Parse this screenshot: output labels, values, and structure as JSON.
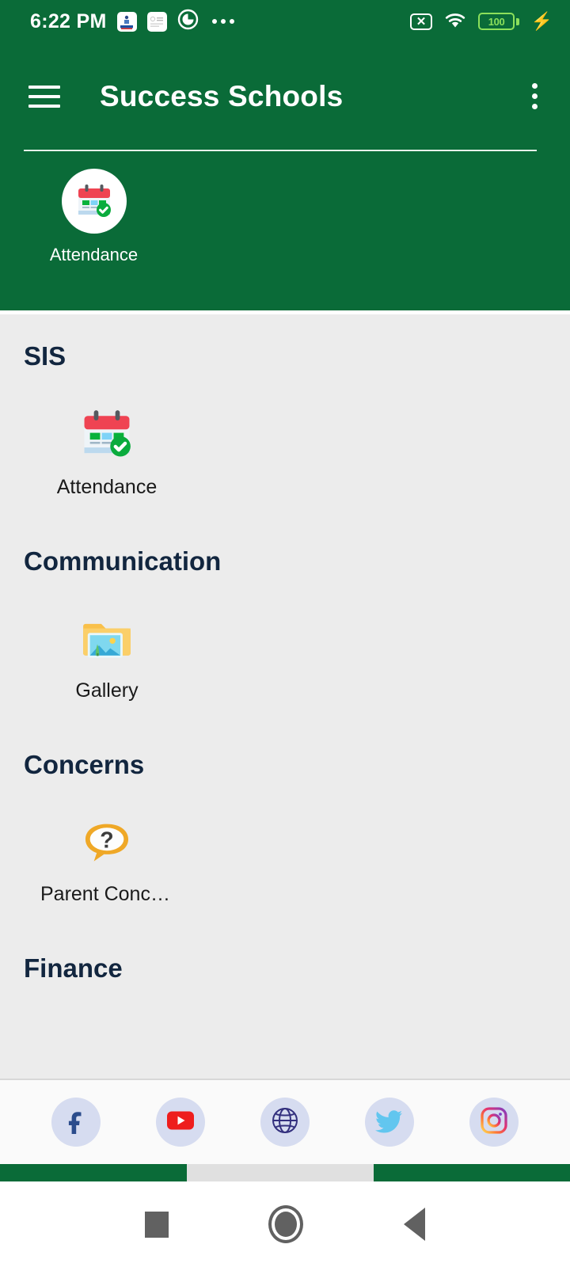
{
  "status_bar": {
    "time": "6:22 PM",
    "notification_icons": [
      "app-badge-icon",
      "document-icon",
      "quicksupport-icon",
      "more-notifications-icon"
    ],
    "sim_icon": "no-sim-icon",
    "sim_glyph": "✕",
    "wifi_icon": "wifi-icon",
    "battery_level": "100",
    "battery_icon": "battery-icon",
    "charging_icon": "charging-bolt-icon",
    "charging_glyph": "⚡"
  },
  "app_bar": {
    "menu_icon": "hamburger-menu-icon",
    "title": "Success Schools",
    "overflow_icon": "overflow-menu-icon"
  },
  "favorites": {
    "items": [
      {
        "label": "Attendance",
        "icon": "calendar-check-icon"
      }
    ]
  },
  "sections": [
    {
      "title": "SIS",
      "items": [
        {
          "label": "Attendance",
          "icon": "calendar-check-icon"
        }
      ]
    },
    {
      "title": "Communication",
      "items": [
        {
          "label": "Gallery",
          "icon": "photo-folder-icon"
        }
      ]
    },
    {
      "title": "Concerns",
      "items": [
        {
          "label": "Parent Conce…",
          "icon": "question-bubble-icon"
        }
      ]
    },
    {
      "title": "Finance",
      "items": []
    }
  ],
  "social_bar": {
    "items": [
      {
        "name": "facebook",
        "icon": "facebook-icon"
      },
      {
        "name": "youtube",
        "icon": "youtube-icon"
      },
      {
        "name": "website",
        "icon": "globe-icon"
      },
      {
        "name": "twitter",
        "icon": "twitter-icon"
      },
      {
        "name": "instagram",
        "icon": "instagram-icon"
      }
    ]
  },
  "nav_bar": {
    "recents_icon": "recents-square-icon",
    "home_icon": "home-circle-icon",
    "back_icon": "back-triangle-icon"
  },
  "colors": {
    "brand_green": "#0A6B38",
    "section_heading": "#12263F",
    "body_bg": "#ececec",
    "social_bg": "#d6dcf0",
    "battery_green": "#8CE05B"
  }
}
